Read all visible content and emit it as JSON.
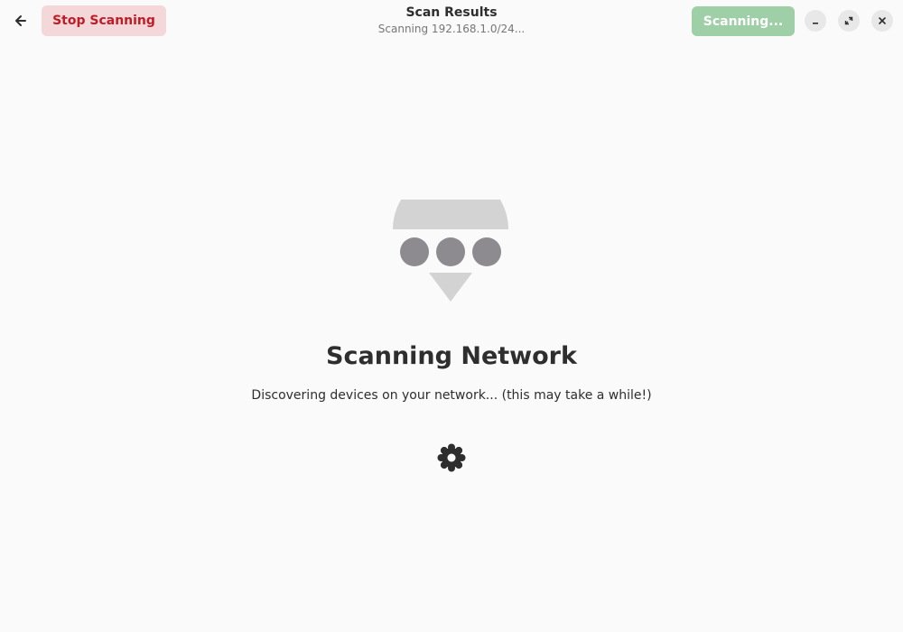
{
  "header": {
    "title": "Scan Results",
    "subtitle": "Scanning 192.168.1.0/24...",
    "back_icon": "arrow-left-icon",
    "stop_button_label": "Stop Scanning",
    "scan_button_label": "Scanning..."
  },
  "window_controls": {
    "minimize_icon": "minimize-icon",
    "maximize_icon": "maximize-icon",
    "close_icon": "close-icon"
  },
  "status": {
    "icon": "network-wireless-scanning-icon",
    "title": "Scanning Network",
    "description": "Discovering devices on your network... (this may take a while!)",
    "spinner_icon": "spinner-icon"
  },
  "colors": {
    "background": "#fafafa",
    "destructive_text": "#c01c28",
    "destructive_bg": "#f4d7d8",
    "suggested_bg_disabled": "#9fcfa6",
    "icon_gray_light": "#d3d3d3",
    "icon_gray_dark": "#8d8b8f"
  }
}
